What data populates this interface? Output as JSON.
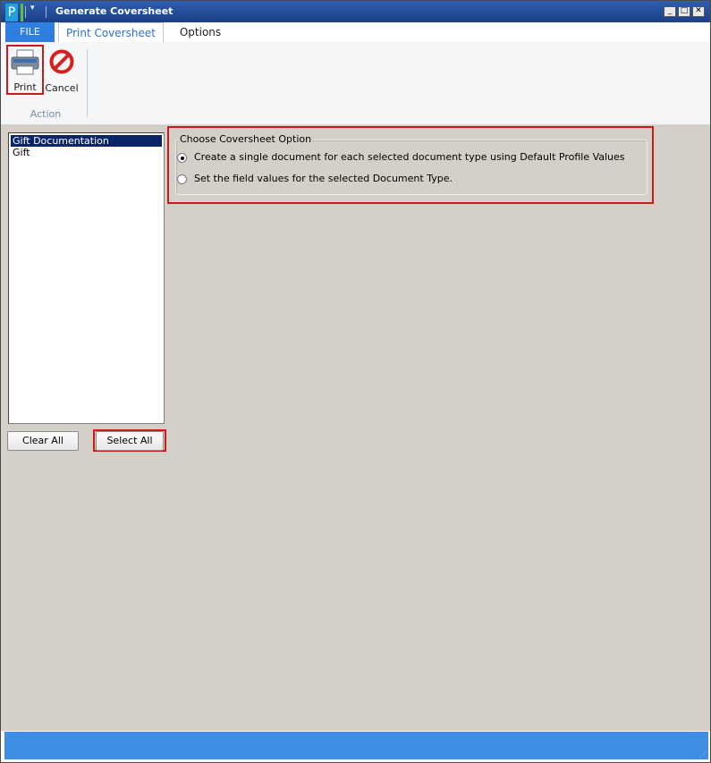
{
  "window": {
    "title": "Generate Coversheet",
    "app_icon_letter": "P",
    "quick_access_arrow": "▾",
    "controls": {
      "minimize": "_",
      "maximize": "□",
      "close": "✕"
    }
  },
  "tabs": [
    {
      "label": "FILE",
      "active": false
    },
    {
      "label": "Print Coversheet",
      "active": true
    },
    {
      "label": "Options",
      "active": false
    }
  ],
  "ribbon": {
    "print_label": "Print",
    "cancel_label": "Cancel",
    "group_label": "Action"
  },
  "document_list": {
    "items": [
      {
        "label": "Gift Documentation",
        "selected": true
      },
      {
        "label": "Gift",
        "selected": false
      }
    ],
    "clear_all_label": "Clear All",
    "select_all_label": "Select All"
  },
  "coversheet_option": {
    "title": "Choose Coversheet Option",
    "options": [
      {
        "label": "Create a single document for each selected document type using Default Profile Values",
        "checked": true
      },
      {
        "label": "Set the field values for the selected Document Type.",
        "checked": false
      }
    ]
  },
  "colors": {
    "title_bar": "#1a3f86",
    "file_tab": "#2f7fe0",
    "status_bar": "#3e8ee6",
    "highlight_outline": "#c81c1c",
    "content_bg": "#d4d0c8"
  }
}
